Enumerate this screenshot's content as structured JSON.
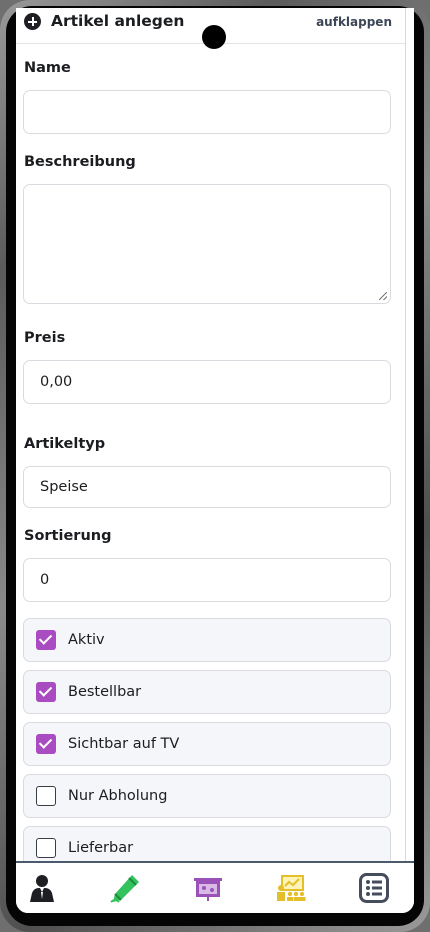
{
  "card": {
    "title": "Artikel anlegen",
    "expand_label": "aufklappen"
  },
  "form": {
    "name": {
      "label": "Name",
      "value": ""
    },
    "description": {
      "label": "Beschreibung",
      "value": ""
    },
    "price": {
      "label": "Preis",
      "value": "0,00"
    },
    "type": {
      "label": "Artikeltyp",
      "value": "Speise"
    },
    "sort": {
      "label": "Sortierung",
      "value": "0"
    }
  },
  "checkboxes": [
    {
      "label": "Aktiv",
      "checked": true
    },
    {
      "label": "Bestellbar",
      "checked": true
    },
    {
      "label": "Sichtbar auf TV",
      "checked": true
    },
    {
      "label": "Nur Abholung",
      "checked": false
    },
    {
      "label": "Lieferbar",
      "checked": false
    }
  ],
  "nav": {
    "items": [
      {
        "icon": "waiter-icon",
        "color": "#1d1f22"
      },
      {
        "icon": "pencil-icon",
        "color": "#33c25c"
      },
      {
        "icon": "presentation-icon",
        "color": "#9a52b8"
      },
      {
        "icon": "audience-chart-icon",
        "color": "#e3c02a"
      },
      {
        "icon": "list-icon",
        "color": "#454d5c"
      }
    ]
  },
  "colors": {
    "accent": "#a94bc1",
    "nav_border": "#4d5a6b"
  }
}
